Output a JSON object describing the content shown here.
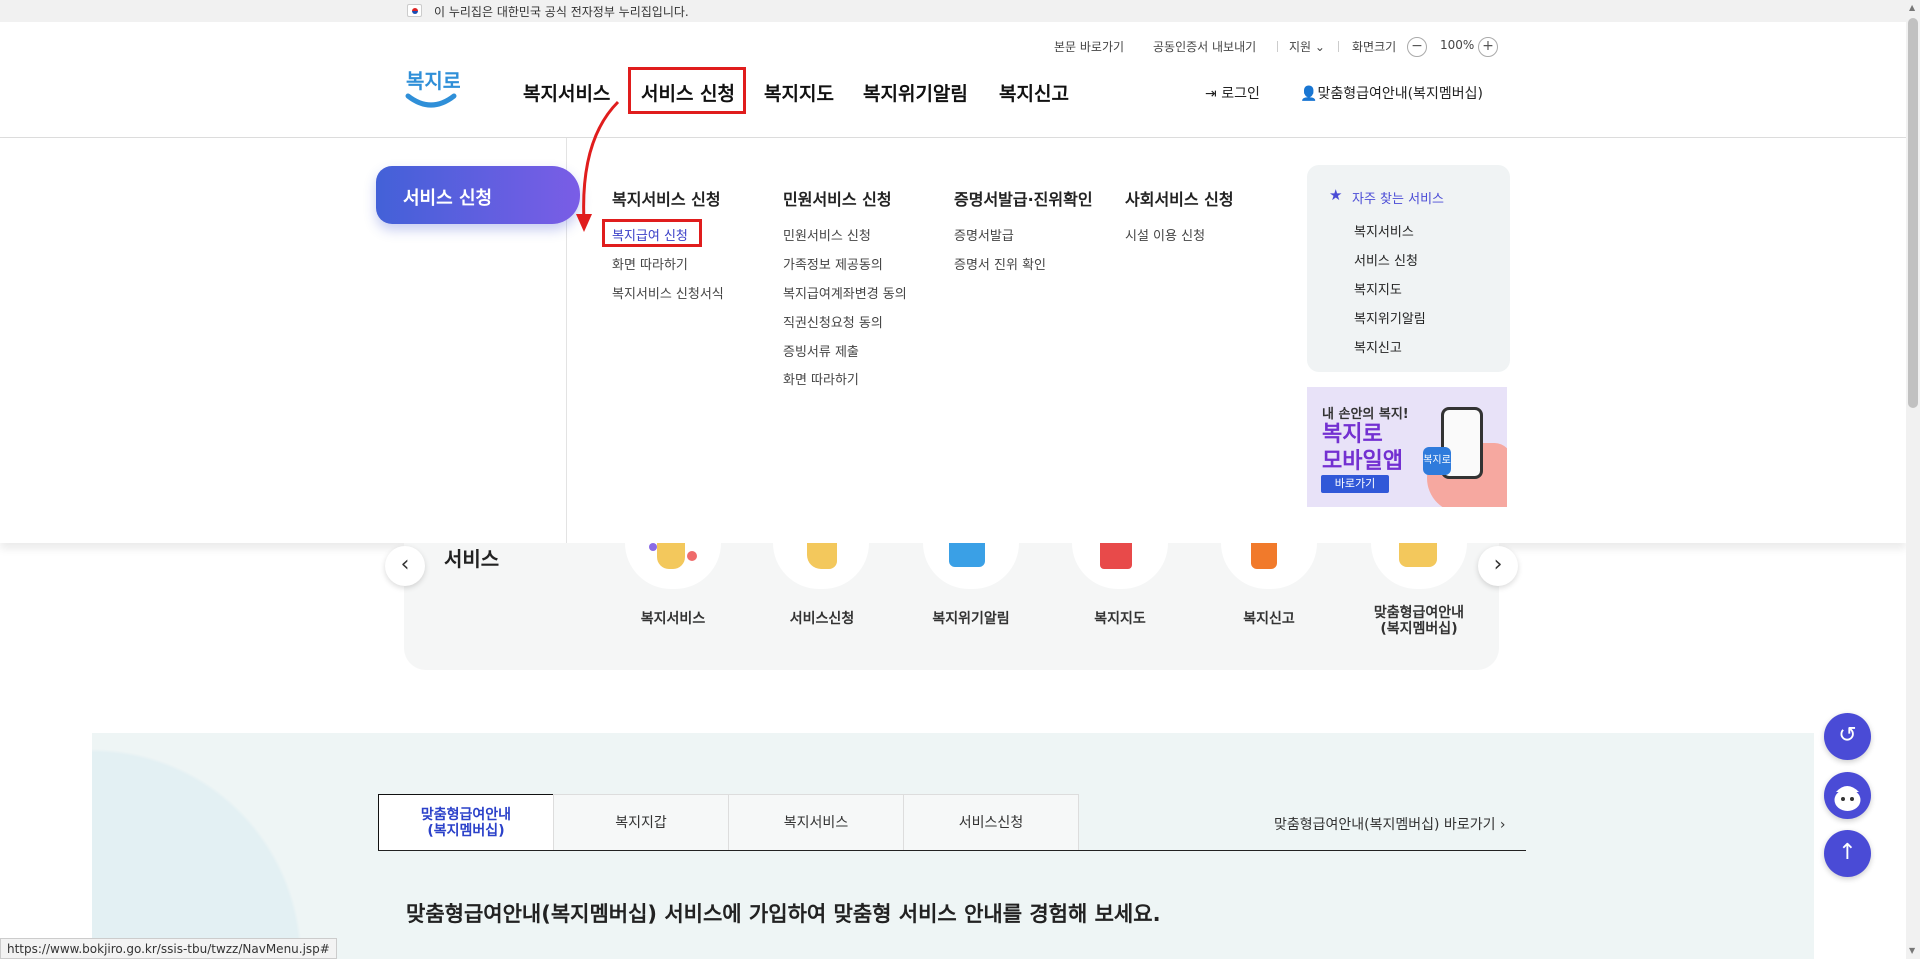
{
  "gov_banner": {
    "text": "이 누리집은 대한민국 공식 전자정부 누리집입니다."
  },
  "utility": {
    "skip_to_content": "본문 바로가기",
    "export_cert": "공동인증서 내보내기",
    "support": "지원",
    "screen_size": "화면크기",
    "zoom_level": "100%",
    "zoom_out": "−",
    "zoom_in": "+"
  },
  "header": {
    "logo_text": "복지로",
    "gnb": [
      "복지서비스",
      "서비스 신청",
      "복지지도",
      "복지위기알림",
      "복지신고"
    ],
    "active_gnb": "서비스 신청",
    "login": "로그인",
    "membership": "맞춤형급여안내(복지멤버십)"
  },
  "mega_menu": {
    "side_tab": "서비스 신청",
    "columns": [
      {
        "title": "복지서비스 신청",
        "items": [
          "복지급여 신청",
          "화면 따라하기",
          "복지서비스 신청서식"
        ]
      },
      {
        "title": "민원서비스 신청",
        "items": [
          "민원서비스 신청",
          "가족정보 제공동의",
          "복지급여계좌변경 동의",
          "직권신청요청 동의",
          "증빙서류 제출",
          "화면 따라하기"
        ]
      },
      {
        "title": "증명서발급·진위확인",
        "items": [
          "증명서발급",
          "증명서 진위 확인"
        ]
      },
      {
        "title": "사회서비스 신청",
        "items": [
          "시설 이용 신청"
        ]
      }
    ],
    "highlighted_item": "복지급여 신청",
    "favorites": {
      "title": "자주 찾는 서비스",
      "items": [
        "복지서비스",
        "서비스 신청",
        "복지지도",
        "복지위기알림",
        "복지신고"
      ]
    },
    "app_banner": {
      "small_text": "내 손안의 복지!",
      "line1": "복지로",
      "line2": "모바일앱",
      "button": "바로가기",
      "icon_text": "복지로"
    }
  },
  "quick_services": {
    "title": "서비스",
    "prev": "‹",
    "next": "›",
    "items": [
      "복지서비스",
      "서비스신청",
      "복지위기알림",
      "복지지도",
      "복지신고",
      "맞춤형급여안내\n(복지멤버십)"
    ]
  },
  "lower_section": {
    "tabs": [
      "맞춤형급여안내\n(복지멤버십)",
      "복지지갑",
      "복지서비스",
      "서비스신청"
    ],
    "active_tab": "맞춤형급여안내\n(복지멤버십)",
    "shortcut": "맞춤형급여안내(복지멤버십) 바로가기 ›",
    "promo": "맞춤형급여안내(복지멤버십) 서비스에 가입하여 맞춤형 서비스 안내를 경험해 보세요."
  },
  "floating": {
    "history_icon": "↺",
    "top_icon": "↑"
  },
  "status_url": "https://www.bokjiro.go.kr/ssis-tbu/twzz/NavMenu.jsp#",
  "colors": {
    "accent": "#4a4bd6",
    "highlight_red": "#e01d1d",
    "active_tab_text": "#2b41c9"
  }
}
